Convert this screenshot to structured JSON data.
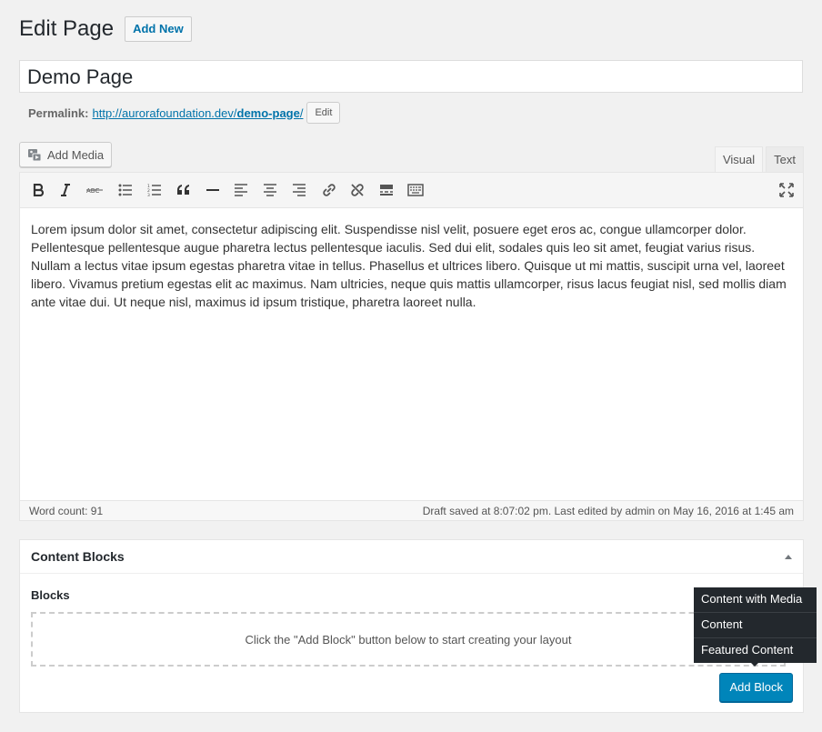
{
  "header": {
    "title": "Edit Page",
    "add_new_label": "Add New"
  },
  "post": {
    "title": "Demo Page",
    "permalink_label": "Permalink:",
    "permalink_base": "http://aurorafoundation.dev/",
    "permalink_slug": "demo-page",
    "permalink_trailing": "/",
    "permalink_edit_label": "Edit"
  },
  "media": {
    "add_media_label": "Add Media"
  },
  "editor_tabs": {
    "visual": "Visual",
    "text": "Text"
  },
  "toolbar_icons": [
    "bold-icon",
    "italic-icon",
    "strikethrough-icon",
    "bullet-list-icon",
    "numbered-list-icon",
    "blockquote-icon",
    "horizontal-rule-icon",
    "align-left-icon",
    "align-center-icon",
    "align-right-icon",
    "insert-link-icon",
    "remove-link-icon",
    "read-more-icon",
    "toolbar-toggle-icon",
    "fullscreen-icon"
  ],
  "content": {
    "body": "Lorem ipsum dolor sit amet, consectetur adipiscing elit. Suspendisse nisl velit, posuere eget eros ac, congue ullamcorper dolor. Pellentesque pellentesque augue pharetra lectus pellentesque iaculis. Sed dui elit, sodales quis leo sit amet, feugiat varius risus. Nullam a lectus vitae ipsum egestas pharetra vitae in tellus. Phasellus et ultrices libero. Quisque ut mi mattis, suscipit urna vel, laoreet libero. Vivamus pretium egestas elit ac maximus. Nam ultricies, neque quis mattis ullamcorper, risus lacus feugiat nisl, sed mollis diam ante vitae dui. Ut neque nisl, maximus id ipsum tristique, pharetra laoreet nulla."
  },
  "status": {
    "word_count": "Word count: 91",
    "saved": "Draft saved at 8:07:02 pm. Last edited by admin on May 16, 2016 at 1:45 am"
  },
  "content_blocks": {
    "title": "Content Blocks",
    "blocks_label": "Blocks",
    "empty_text": "Click the \"Add Block\" button below to start creating your layout",
    "add_block_label": "Add Block",
    "menu_items": [
      "Content with Media",
      "Content",
      "Featured Content"
    ]
  }
}
